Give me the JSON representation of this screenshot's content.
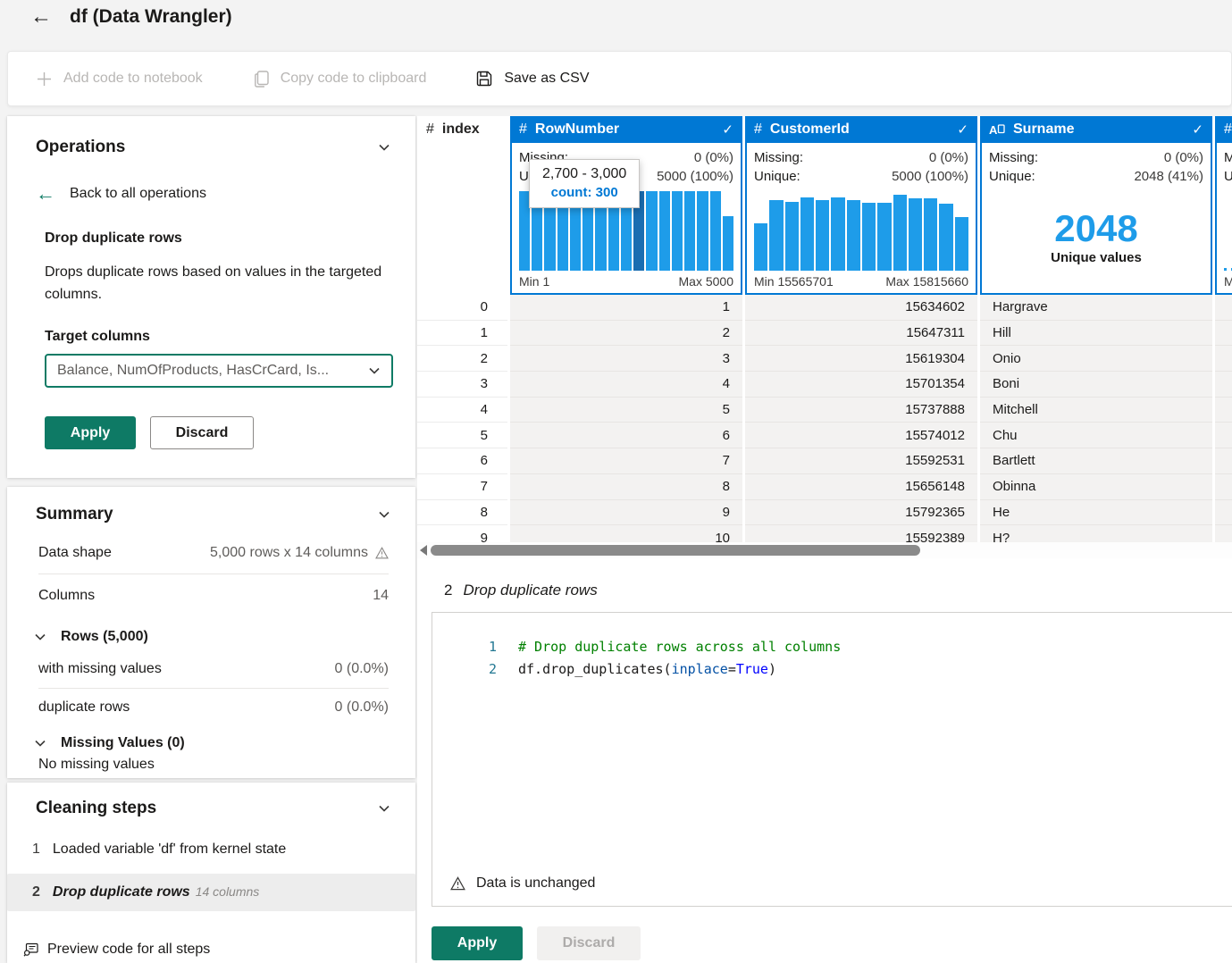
{
  "colors": {
    "header_blue": "#0078d4",
    "bar": "#1e9ce9",
    "bar_hover": "#1a6db1",
    "teal": "#0e7a65"
  },
  "title_bar": {
    "title": "df (Data Wrangler)"
  },
  "toolbar": {
    "add_code": "Add code to notebook",
    "copy_code": "Copy code to clipboard",
    "save_csv": "Save as CSV"
  },
  "operations": {
    "header": "Operations",
    "back_label": "Back to all operations",
    "op_name": "Drop duplicate rows",
    "op_desc": "Drops duplicate rows based on values in the targeted columns.",
    "target_label": "Target columns",
    "dropdown_value": "Balance, NumOfProducts, HasCrCard, Is...",
    "apply_label": "Apply",
    "discard_label": "Discard"
  },
  "summary": {
    "header": "Summary",
    "data_shape_label": "Data shape",
    "data_shape_value": "5,000 rows x 14 columns",
    "columns_label": "Columns",
    "columns_value": "14",
    "rows_group": "Rows (5,000)",
    "missing_rows_label": "with missing values",
    "missing_rows_value": "0 (0.0%)",
    "dup_rows_label": "duplicate rows",
    "dup_rows_value": "0 (0.0%)",
    "missing_group": "Missing Values (0)",
    "missing_note": "No missing values"
  },
  "cleaning_steps": {
    "header": "Cleaning steps",
    "step1_num": "1",
    "step1_text": "Loaded variable 'df' from kernel state",
    "step2_num": "2",
    "step2_text": "Drop duplicate rows",
    "step2_meta": "14 columns",
    "preview_label": "Preview code for all steps"
  },
  "tooltip": {
    "range": "2,700 - 3,000",
    "count": "count: 300"
  },
  "grid": {
    "index_header": "index",
    "columns": [
      {
        "name": "RowNumber",
        "type": "numeric",
        "missing_label": "Missing:",
        "missing": "0 (0%)",
        "unique_label": "Unique:",
        "unique": "5000 (100%)",
        "min": "Min 1",
        "max": "Max 5000",
        "hist": {
          "bars": [
            1,
            1,
            1,
            1,
            1,
            1,
            1,
            1,
            1,
            1,
            1,
            1,
            1,
            1,
            1,
            1,
            0.68
          ],
          "hover_index": 9
        }
      },
      {
        "name": "CustomerId",
        "type": "numeric",
        "missing_label": "Missing:",
        "missing": "0 (0%)",
        "unique_label": "Unique:",
        "unique": "5000 (100%)",
        "min": "Min 15565701",
        "max": "Max 15815660",
        "hist": {
          "bars": [
            0.6,
            0.89,
            0.87,
            0.92,
            0.89,
            0.92,
            0.89,
            0.85,
            0.85,
            0.95,
            0.91,
            0.91,
            0.84,
            0.67
          ],
          "hover_index": -1
        }
      },
      {
        "name": "Surname",
        "type": "text",
        "missing_label": "Missing:",
        "missing": "0 (0%)",
        "unique_label": "Unique:",
        "unique": "2048 (41%)",
        "big_value": "2048",
        "big_label": "Unique values"
      }
    ],
    "partial_column": {
      "stats": [
        "Mi",
        "Un"
      ],
      "footer": "Mi"
    },
    "rows": [
      [
        "0",
        "1",
        "15634602",
        "Hargrave"
      ],
      [
        "1",
        "2",
        "15647311",
        "Hill"
      ],
      [
        "2",
        "3",
        "15619304",
        "Onio"
      ],
      [
        "3",
        "4",
        "15701354",
        "Boni"
      ],
      [
        "4",
        "5",
        "15737888",
        "Mitchell"
      ],
      [
        "5",
        "6",
        "15574012",
        "Chu"
      ],
      [
        "6",
        "7",
        "15592531",
        "Bartlett"
      ],
      [
        "7",
        "8",
        "15656148",
        "Obinna"
      ],
      [
        "8",
        "9",
        "15792365",
        "He"
      ],
      [
        "9",
        "10",
        "15592389",
        "H?"
      ]
    ]
  },
  "code_panel": {
    "step_num": "2",
    "step_name": "Drop duplicate rows",
    "lines": [
      {
        "num": "1",
        "tokens": [
          {
            "text": "# Drop duplicate rows across all columns",
            "type": "comment"
          }
        ]
      },
      {
        "num": "2",
        "tokens": [
          {
            "text": "df.drop_duplicates(",
            "type": "plain"
          },
          {
            "text": "inplace",
            "type": "param"
          },
          {
            "text": "=",
            "type": "plain"
          },
          {
            "text": "True",
            "type": "keyword"
          },
          {
            "text": ")",
            "type": "plain"
          }
        ]
      }
    ],
    "warning": "Data is unchanged",
    "apply_label": "Apply",
    "discard_label": "Discard"
  }
}
